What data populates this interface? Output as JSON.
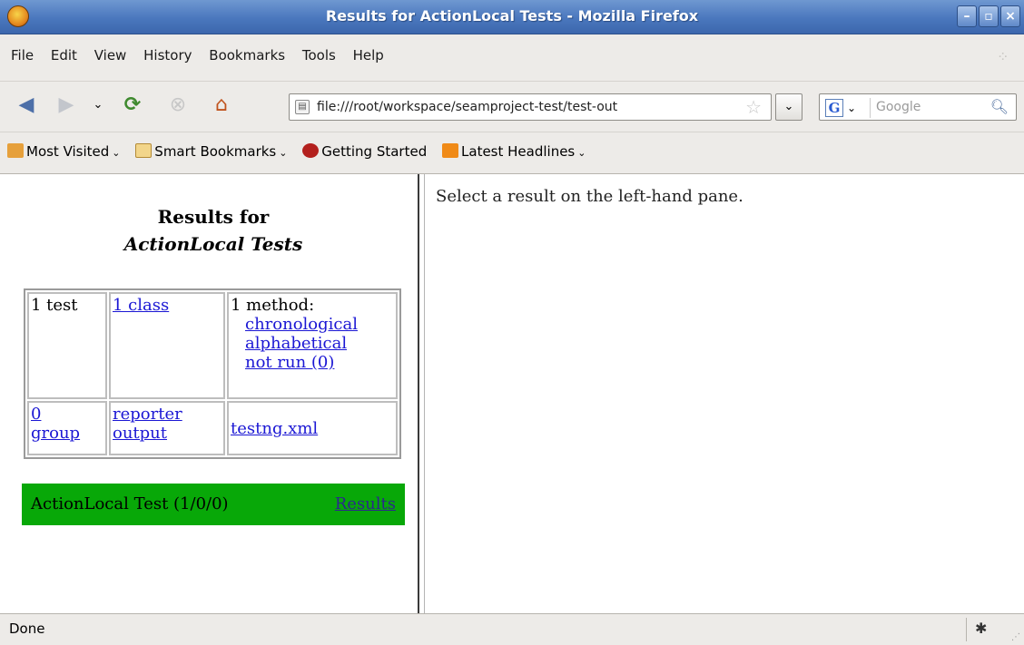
{
  "window": {
    "title": "Results for ActionLocal Tests - Mozilla Firefox",
    "app_icon": "firefox-icon",
    "buttons": [
      "minimize-icon",
      "maximize-icon",
      "close-icon"
    ]
  },
  "menu": {
    "items": [
      "File",
      "Edit",
      "View",
      "History",
      "Bookmarks",
      "Tools",
      "Help"
    ]
  },
  "navigation": {
    "url": "file:///root/workspace/seamproject-test/test-out",
    "search_placeholder": "Google",
    "icons": [
      "back-icon",
      "forward-icon",
      "history-dropdown-icon",
      "reload-icon",
      "stop-icon",
      "home-icon",
      "bookmark-star-icon",
      "search-icon"
    ]
  },
  "bookmarks": {
    "items": [
      {
        "label": "Most Visited",
        "icon": "most-visited-icon",
        "dropdown": true
      },
      {
        "label": "Smart Bookmarks",
        "icon": "folder-icon",
        "dropdown": true
      },
      {
        "label": "Getting Started",
        "icon": "getting-started-icon",
        "dropdown": false
      },
      {
        "label": "Latest Headlines",
        "icon": "rss-icon",
        "dropdown": true
      }
    ]
  },
  "left_pane": {
    "title_line1": "Results for",
    "title_line2": "ActionLocal Tests",
    "summary": {
      "tests": "1 test",
      "classes": "1 class",
      "methods_label": "1 method:",
      "chronological": "chronological",
      "alphabetical": "alphabetical",
      "not_run": "not run (0)",
      "group_line1": "0",
      "group_line2": "group",
      "reporter_line1": "reporter",
      "reporter_line2": "output",
      "testng": "testng.xml"
    },
    "test_entry": {
      "name": "ActionLocal Test (1/0/0)",
      "link": "Results",
      "status_color": "#08a808"
    }
  },
  "right_pane": {
    "message": "Select a result on the left-hand pane."
  },
  "status": {
    "text": "Done"
  }
}
